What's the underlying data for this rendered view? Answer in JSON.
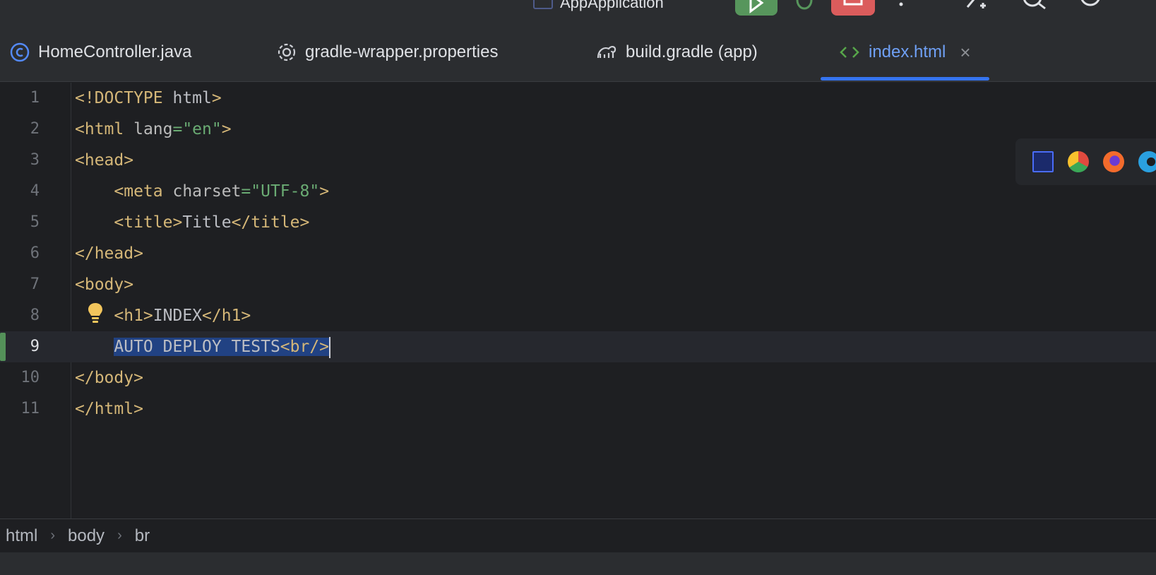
{
  "toolbar": {
    "run_config_label": "AppApplication"
  },
  "tabs": [
    {
      "label": "HomeController.java",
      "icon": "class-icon"
    },
    {
      "label": "gradle-wrapper.properties",
      "icon": "gear-icon"
    },
    {
      "label": "build.gradle (app)",
      "icon": "gradle-icon"
    },
    {
      "label": "index.html",
      "icon": "html-icon",
      "active": true
    }
  ],
  "close_symbol": "×",
  "editor": {
    "lines": [
      {
        "num": "1",
        "indent": "",
        "parts": [
          {
            "t": "tag",
            "v": "<!DOCTYPE "
          },
          {
            "t": "txt",
            "v": "html"
          },
          {
            "t": "tag",
            "v": ">"
          }
        ]
      },
      {
        "num": "2",
        "indent": "",
        "parts": [
          {
            "t": "tag",
            "v": "<html "
          },
          {
            "t": "attr",
            "v": "lang"
          },
          {
            "t": "val",
            "v": "=\"en\""
          },
          {
            "t": "tag",
            "v": ">"
          }
        ]
      },
      {
        "num": "3",
        "indent": "",
        "parts": [
          {
            "t": "tag",
            "v": "<head>"
          }
        ]
      },
      {
        "num": "4",
        "indent": "    ",
        "parts": [
          {
            "t": "tag",
            "v": "<meta "
          },
          {
            "t": "attr",
            "v": "charset"
          },
          {
            "t": "val",
            "v": "=\"UTF-8\""
          },
          {
            "t": "tag",
            "v": ">"
          }
        ]
      },
      {
        "num": "5",
        "indent": "    ",
        "parts": [
          {
            "t": "tag",
            "v": "<title>"
          },
          {
            "t": "txt",
            "v": "Title"
          },
          {
            "t": "tag",
            "v": "</title>"
          }
        ]
      },
      {
        "num": "6",
        "indent": "",
        "parts": [
          {
            "t": "tag",
            "v": "</head>"
          }
        ]
      },
      {
        "num": "7",
        "indent": "",
        "parts": [
          {
            "t": "tag",
            "v": "<body>"
          }
        ]
      },
      {
        "num": "8",
        "indent": "    ",
        "parts": [
          {
            "t": "tag",
            "v": "<h1>"
          },
          {
            "t": "txt",
            "v": "INDEX"
          },
          {
            "t": "tag",
            "v": "</h1>"
          }
        ]
      },
      {
        "num": "9",
        "indent": "    ",
        "current": true,
        "parts": [
          {
            "t": "txt",
            "v": "AUTO DEPLOY TESTS",
            "sel": true
          },
          {
            "t": "tag",
            "v": "<br/>",
            "sel": true
          }
        ]
      },
      {
        "num": "10",
        "indent": "",
        "parts": [
          {
            "t": "tag",
            "v": "</body>"
          }
        ]
      },
      {
        "num": "11",
        "indent": "",
        "parts": [
          {
            "t": "tag",
            "v": "</html>"
          }
        ]
      }
    ]
  },
  "browser_popup": {
    "items": [
      "intellij-icon",
      "chrome-icon",
      "firefox-icon",
      "edge-icon"
    ]
  },
  "breadcrumb": [
    "html",
    "body",
    "br"
  ],
  "colors": {
    "accent": "#3574f0",
    "run": "#57965c",
    "stop": "#db5c5c",
    "selection": "#214283"
  }
}
